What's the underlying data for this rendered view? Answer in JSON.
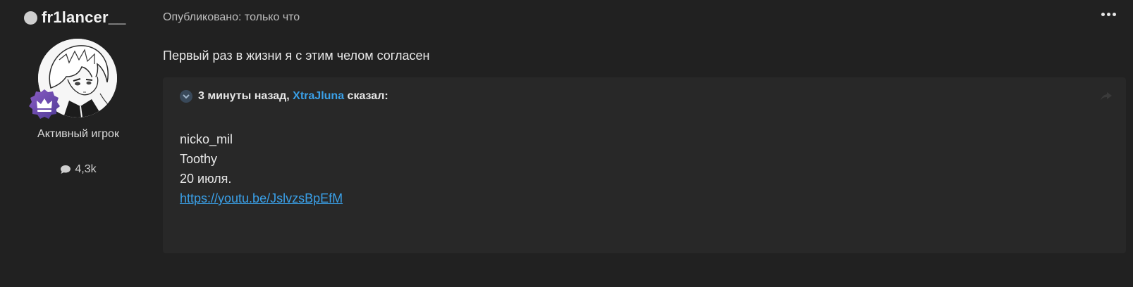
{
  "author": {
    "username": "fr1lancer__",
    "role": "Активный игрок",
    "post_count": "4,3k",
    "status_icon": "offline-dot-icon",
    "avatar": "anime-character-avatar",
    "rank_icon": "crown-icon"
  },
  "post": {
    "meta": "Опубликовано: только что",
    "text": "Первый раз в жизни я с этим челом согласен",
    "menu_icon": "ellipsis-icon"
  },
  "quote": {
    "time": "3 минуты назад,",
    "author": "XtraJluna",
    "said": "сказал:",
    "lines": [
      "nicko_mil",
      "Toothy",
      "20 июля."
    ],
    "link": "https://youtu.be/JslvzsBpEfM"
  },
  "colors": {
    "background": "#212121",
    "quote_background": "#282828",
    "accent": "#3aa0e8",
    "badge": "#6b4fa8"
  }
}
